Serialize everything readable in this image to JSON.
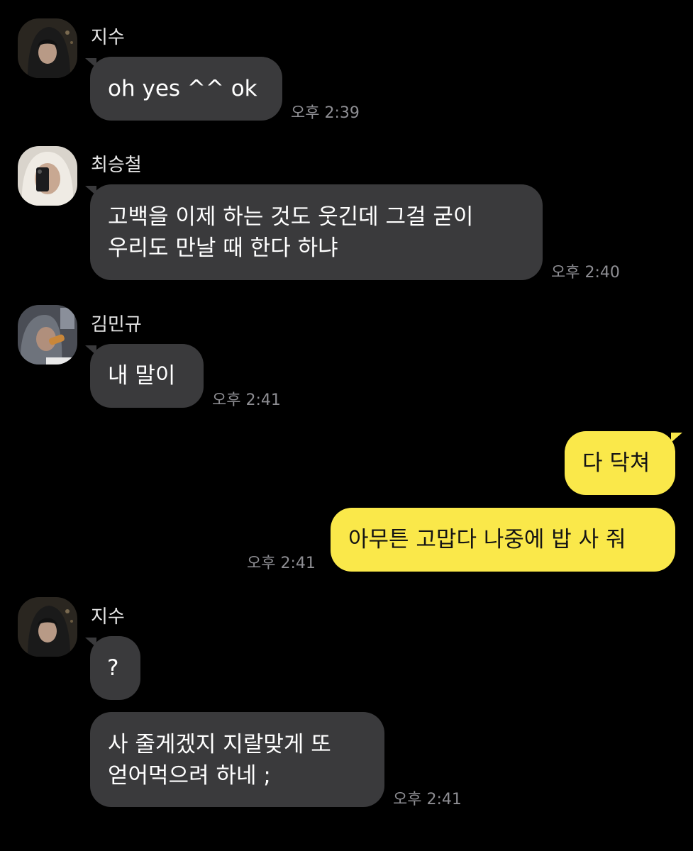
{
  "messages": [
    {
      "sender": "지수",
      "avatar_icon": "hooded-person-avatar",
      "bubbles": [
        {
          "lines": [
            "oh yes ^^ ok"
          ]
        }
      ],
      "time": "오후 2:39"
    },
    {
      "sender": "최승철",
      "avatar_icon": "selfie-hood-avatar",
      "bubbles": [
        {
          "lines": [
            "고백을 이제 하는 것도 웃긴데 그걸 굳이",
            "우리도 만날 때 한다 하냐"
          ]
        }
      ],
      "time": "오후 2:40"
    },
    {
      "sender": "김민규",
      "avatar_icon": "eating-person-avatar",
      "bubbles": [
        {
          "lines": [
            "내 말이"
          ]
        }
      ],
      "time": "오후 2:41"
    },
    {
      "sender": "",
      "from_me": true,
      "bubbles": [
        {
          "lines": [
            "다 닥쳐"
          ]
        },
        {
          "lines": [
            "아무튼 고맙다 나중에 밥 사 줘"
          ]
        }
      ],
      "time": "오후 2:41"
    },
    {
      "sender": "지수",
      "avatar_icon": "hooded-person-avatar",
      "bubbles": [
        {
          "lines": [
            "?"
          ]
        },
        {
          "lines": [
            "사 줄게겠지 지랄맞게 또",
            "얻어먹으려 하네 ;"
          ]
        }
      ],
      "time": "오후 2:41"
    }
  ],
  "colors": {
    "background": "#000000",
    "incoming_bubble": "#3a3a3c",
    "outgoing_bubble": "#fae84a",
    "timestamp": "#8e8e93"
  }
}
